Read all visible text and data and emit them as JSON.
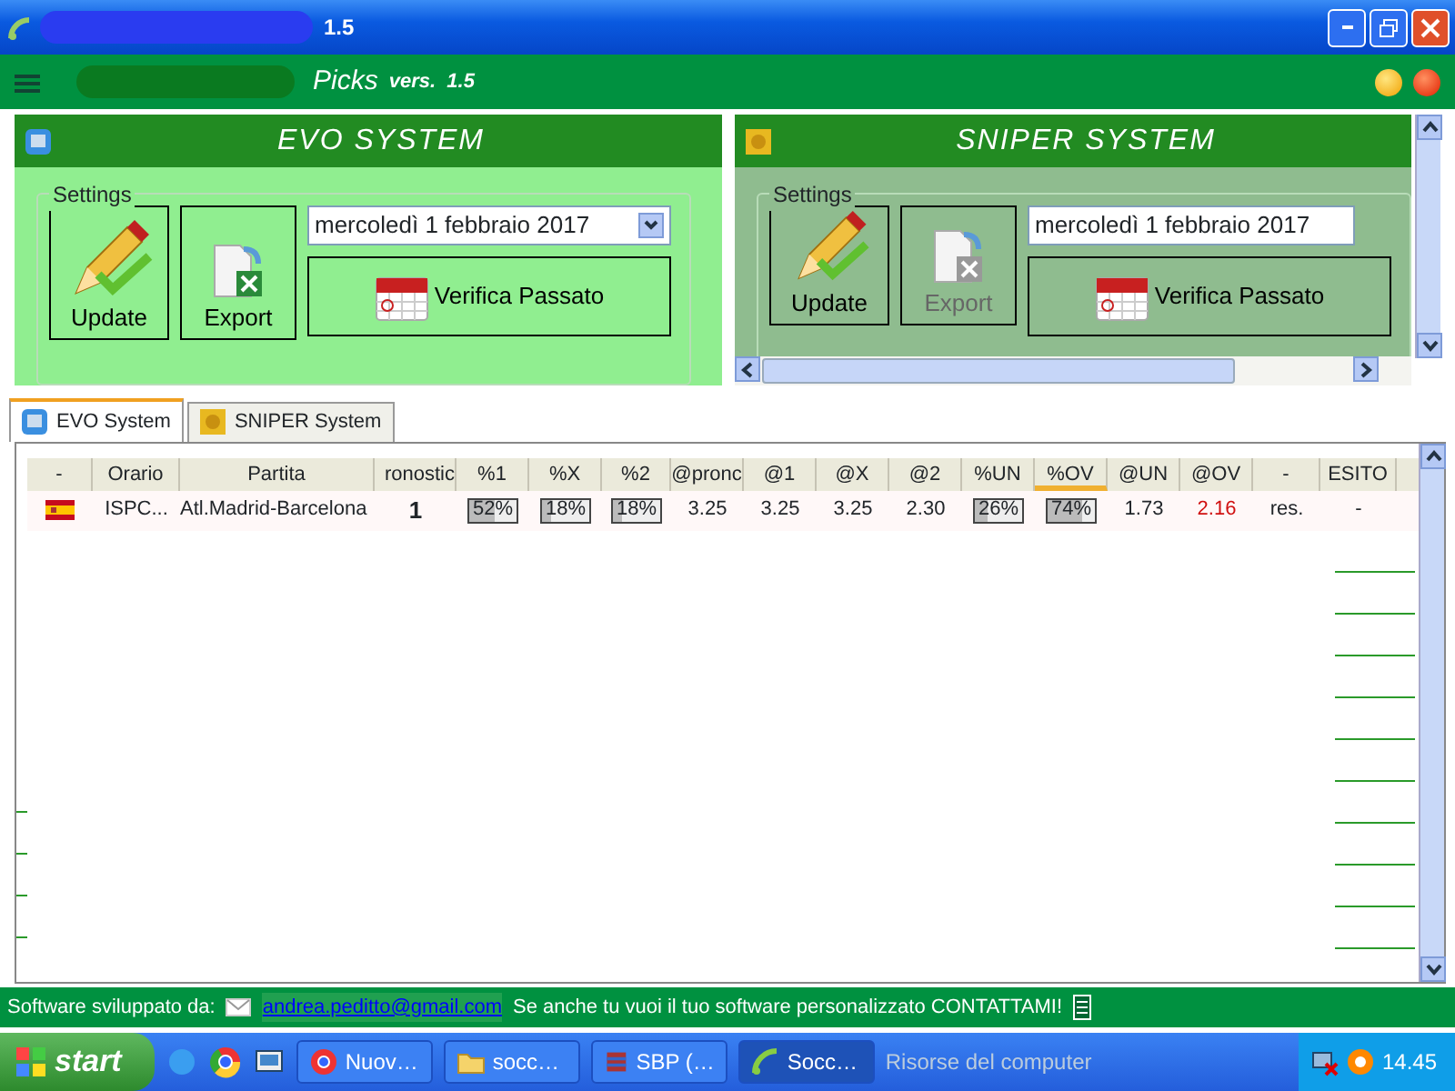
{
  "window": {
    "title": "1.5"
  },
  "app_header": {
    "title": "Picks",
    "version": "vers.  1.5"
  },
  "panels": [
    {
      "title": "EVO SYSTEM",
      "kind": "evo",
      "settings_label": "Settings",
      "update_label": "Update",
      "export_label": "Export",
      "export_disabled": false,
      "date": "mercoledì  1  febbraio  2017",
      "verify_label": "Verifica Passato"
    },
    {
      "title": "SNIPER SYSTEM",
      "kind": "sniper",
      "settings_label": "Settings",
      "update_label": "Update",
      "export_label": "Export",
      "export_disabled": true,
      "date": "mercoledì  1  febbraio  2017",
      "verify_label": "Verifica Passato"
    }
  ],
  "tabs": [
    {
      "label": "EVO System",
      "kind": "evo",
      "selected": true
    },
    {
      "label": "SNIPER System",
      "kind": "sniper",
      "selected": false
    }
  ],
  "table": {
    "columns": [
      {
        "label": "-",
        "sorted": false
      },
      {
        "label": "Orario",
        "sorted": false
      },
      {
        "label": "Partita",
        "sorted": false
      },
      {
        "label": "ronostic",
        "sorted": false
      },
      {
        "label": "%1",
        "sorted": false
      },
      {
        "label": "%X",
        "sorted": false
      },
      {
        "label": "%2",
        "sorted": false
      },
      {
        "label": "@pronc",
        "sorted": false
      },
      {
        "label": "@1",
        "sorted": false
      },
      {
        "label": "@X",
        "sorted": false
      },
      {
        "label": "@2",
        "sorted": false
      },
      {
        "label": "%UN",
        "sorted": false
      },
      {
        "label": "%OV",
        "sorted": true
      },
      {
        "label": "@UN",
        "sorted": false
      },
      {
        "label": "@OV",
        "sorted": false
      },
      {
        "label": "-",
        "sorted": false
      },
      {
        "label": "ESITO",
        "sorted": false
      }
    ],
    "rows": [
      {
        "cells": [
          {
            "kind": "flag"
          },
          {
            "kind": "text",
            "text": "ISPC..."
          },
          {
            "kind": "text",
            "text": "Atl.Madrid-Barcelona"
          },
          {
            "kind": "bold",
            "text": "1"
          },
          {
            "kind": "bar",
            "text": "52%",
            "level": 0.52
          },
          {
            "kind": "bar",
            "text": "18%",
            "level": 0.18
          },
          {
            "kind": "bar",
            "text": "18%",
            "level": 0.18
          },
          {
            "kind": "text",
            "text": "3.25"
          },
          {
            "kind": "text",
            "text": "3.25"
          },
          {
            "kind": "text",
            "text": "3.25"
          },
          {
            "kind": "text",
            "text": "2.30"
          },
          {
            "kind": "bar",
            "text": "26%",
            "level": 0.26
          },
          {
            "kind": "bar",
            "text": "74%",
            "level": 0.74
          },
          {
            "kind": "text",
            "text": "1.73"
          },
          {
            "kind": "alert",
            "text": "2.16"
          },
          {
            "kind": "text",
            "text": "res."
          },
          {
            "kind": "text",
            "text": "-"
          }
        ]
      }
    ]
  },
  "footer": {
    "label": "Software sviluppato da:",
    "email": "andrea.peditto@gmail.com",
    "message": "Se anche tu vuoi il tuo software personalizzato CONTATTAMI!"
  },
  "taskbar": {
    "start": "start",
    "tasks": [
      {
        "label": "Nuov…",
        "kind": "browser",
        "selected": false
      },
      {
        "label": "socc…",
        "kind": "folder",
        "selected": false
      },
      {
        "label": "SBP (…",
        "kind": "archive",
        "selected": false
      },
      {
        "label": "Socc…",
        "kind": "app",
        "selected": true
      }
    ],
    "toolbar": "Risorse del computer",
    "clock": "14.45"
  }
}
